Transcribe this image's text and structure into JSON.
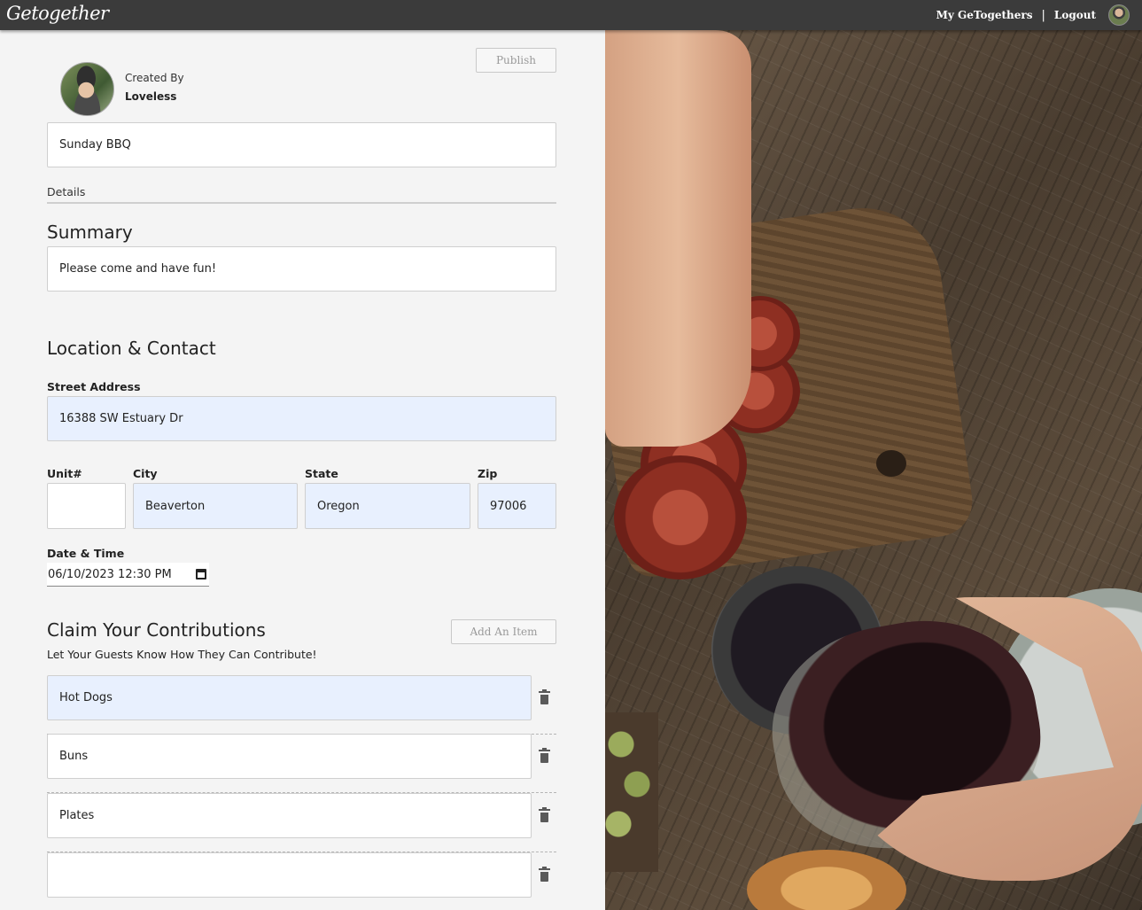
{
  "app": {
    "logo": "Getogether"
  },
  "nav": {
    "my_gettogethers": "My GeTogethers",
    "separator": "|",
    "logout": "Logout"
  },
  "event": {
    "publish_label": "Publish",
    "created_by_label": "Created By",
    "creator_name": "Loveless",
    "title_value": "Sunday BBQ",
    "details_label": "Details",
    "summary_heading": "Summary",
    "summary_value": "Please come and have fun!"
  },
  "location": {
    "heading": "Location & Contact",
    "street_label": "Street Address",
    "street_value": "16388 SW Estuary Dr",
    "unit_label": "Unit#",
    "unit_value": "",
    "city_label": "City",
    "city_value": "Beaverton",
    "state_label": "State",
    "state_value": "Oregon",
    "zip_label": "Zip",
    "zip_value": "97006",
    "datetime_label": "Date & Time",
    "datetime_value": "06/10/2023 12:30 PM"
  },
  "contributions": {
    "heading": "Claim Your Contributions",
    "add_item_label": "Add An Item",
    "subtitle": "Let Your Guests Know How They Can Contribute!",
    "items": [
      {
        "value": "Hot Dogs"
      },
      {
        "value": "Buns"
      },
      {
        "value": "Plates"
      },
      {
        "value": ""
      }
    ]
  },
  "icons": {
    "trash": "trash-icon",
    "calendar": "calendar-icon"
  }
}
